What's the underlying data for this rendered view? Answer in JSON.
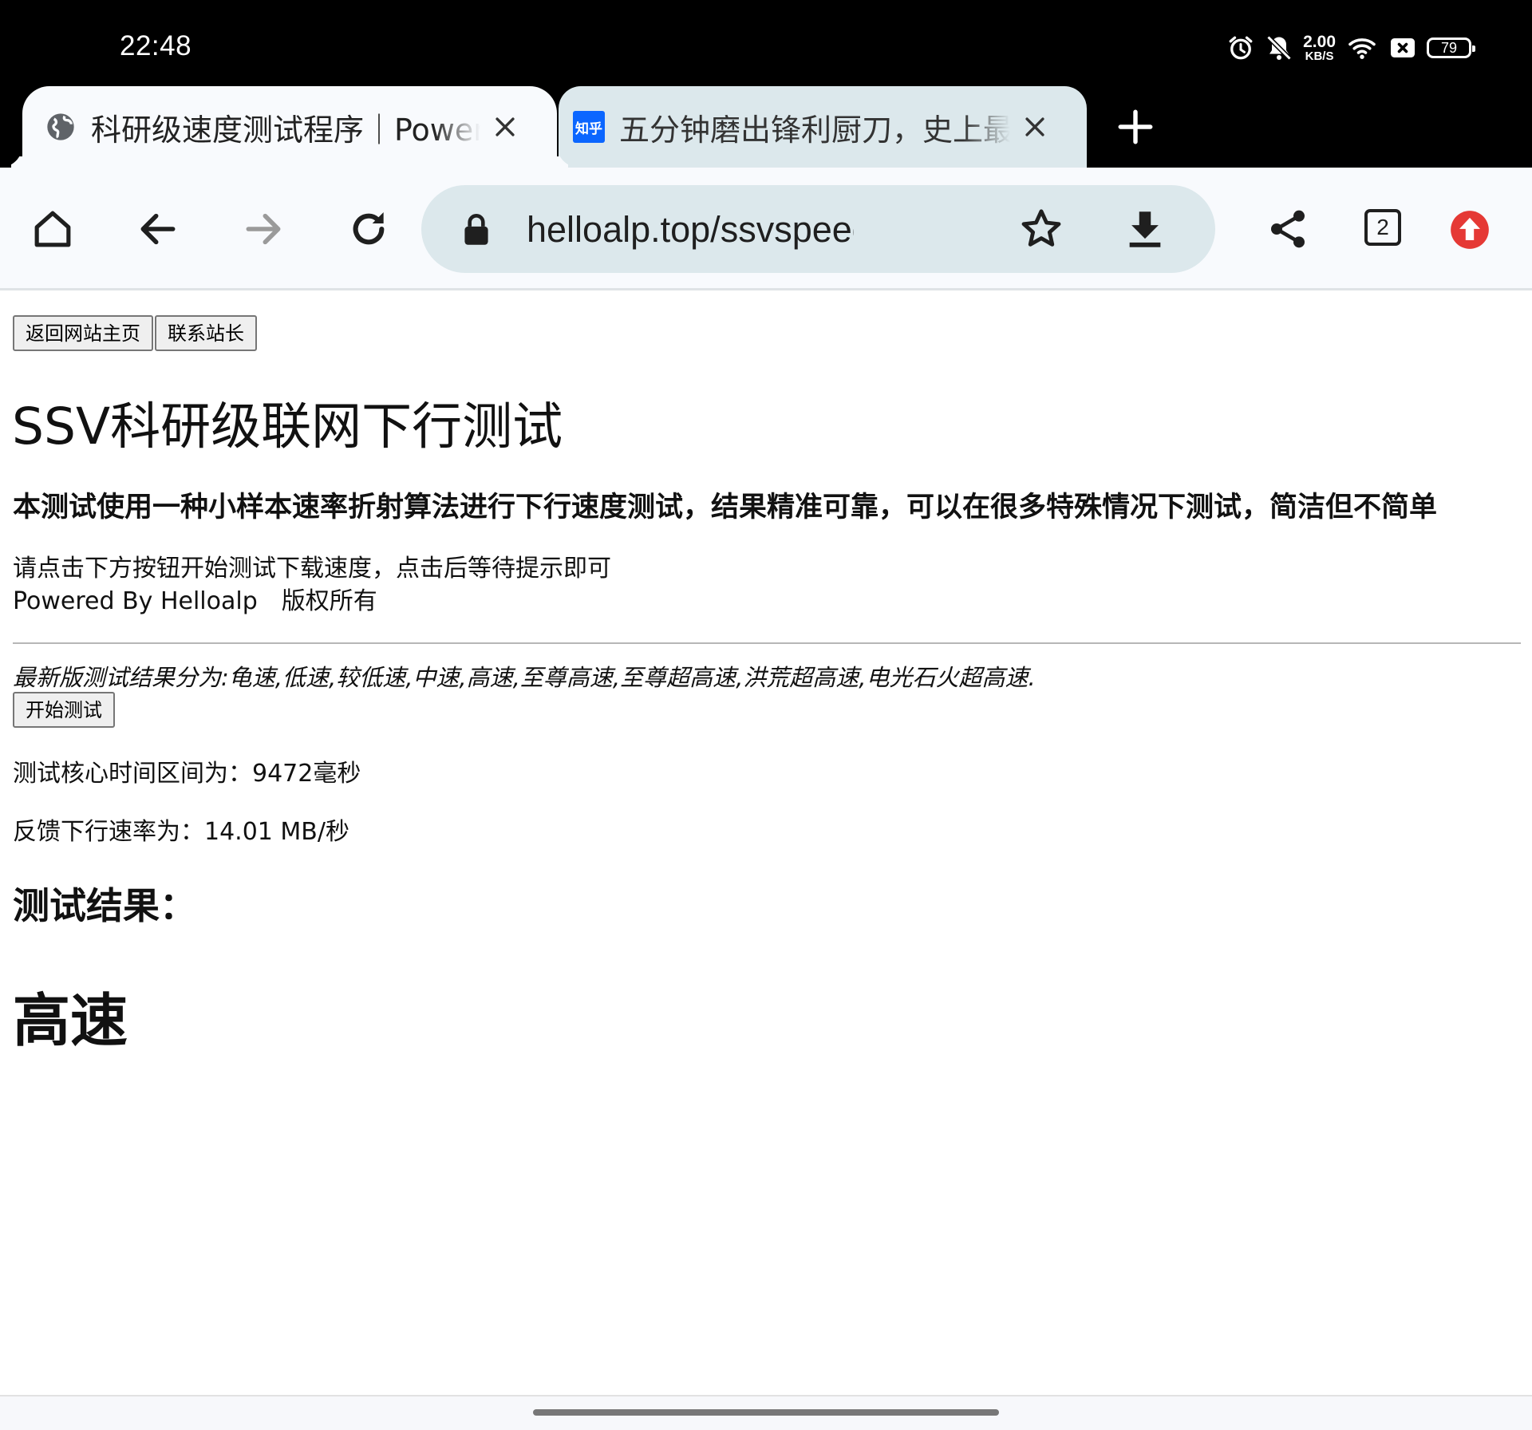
{
  "status_bar": {
    "time": "22:48",
    "net_speed_value": "2.00",
    "net_speed_unit": "KB/S",
    "battery": "79",
    "icons": [
      "alarm-icon",
      "muted-bell-icon",
      "wifi-icon",
      "sim-disabled-icon",
      "battery-icon"
    ]
  },
  "tabs": [
    {
      "title": "科研级速度测试程序｜Powered By Helloalp",
      "favicon": "globe-icon",
      "active": true
    },
    {
      "title": "五分钟磨出锋利厨刀，史上最全磨刀指南",
      "favicon": "zhihu-icon",
      "favicon_text": "知乎",
      "active": false
    }
  ],
  "toolbar": {
    "url": "helloalp.top/ssvspeedtest.html",
    "tab_count": "2",
    "accent_update_color": "#e53935"
  },
  "page": {
    "nav_buttons": [
      "返回网站主页",
      "联系站长"
    ],
    "heading": "SSV科研级联网下行测试",
    "intro": "本测试使用一种小样本速率折射算法进行下行速度测试，结果精准可靠，可以在很多特殊情况下测试，简洁但不简单",
    "instruction": "请点击下方按钮开始测试下载速度，点击后等待提示即可",
    "powered_by": "Powered By Helloalp　版权所有",
    "levels": "最新版测试结果分为:龟速,低速,较低速,中速,高速,至尊高速,至尊超高速,洪荒超高速,电光石火超高速.",
    "start_button": "开始测试",
    "core_time": "测试核心时间区间为：9472毫秒",
    "speed": "反馈下行速率为：14.01 MB/秒",
    "result_label": "测试结果：",
    "result_value": "高速"
  }
}
